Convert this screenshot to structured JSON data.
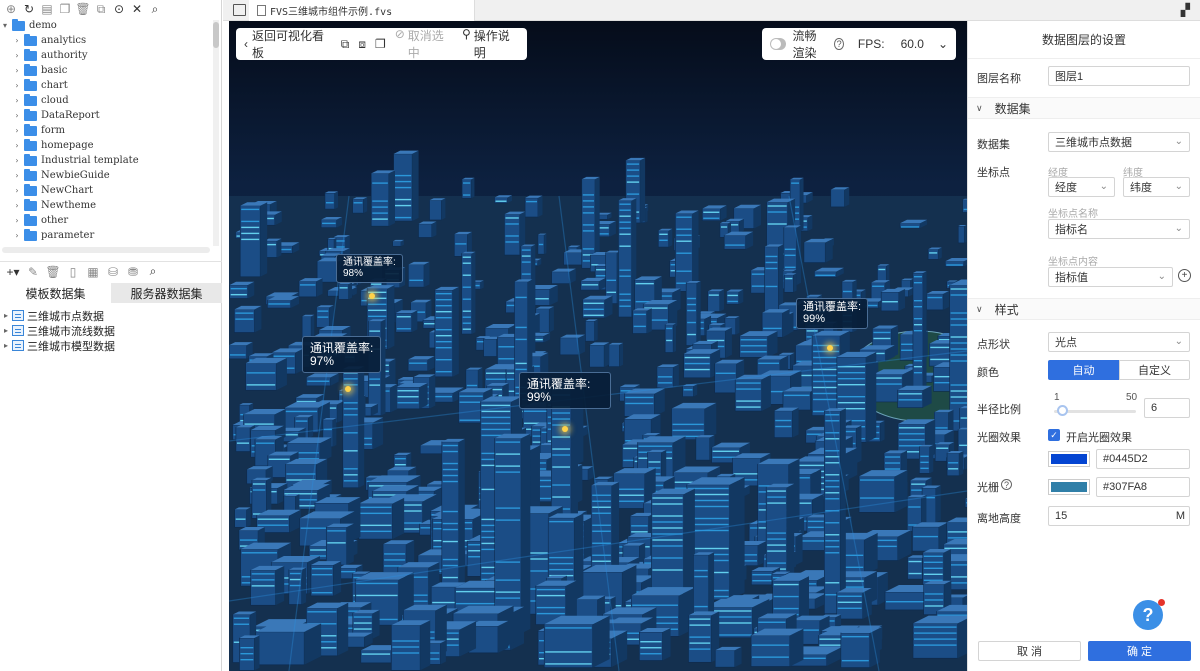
{
  "toolbar_icons": [
    "new-file-icon",
    "refresh-icon",
    "template-icon",
    "copy-icon",
    "delete-icon",
    "duplicate-icon",
    "locate-icon",
    "collapse-icon",
    "search-icon"
  ],
  "tree": {
    "root": "demo",
    "folders": [
      "analytics",
      "authority",
      "basic",
      "chart",
      "cloud",
      "DataReport",
      "form",
      "homepage",
      "Industrial template",
      "NewbieGuide",
      "NewChart",
      "Newtheme",
      "other",
      "parameter"
    ]
  },
  "dataset_tabs": {
    "template": "模板数据集",
    "server": "服务器数据集"
  },
  "datasets": [
    "三维城市点数据",
    "三维城市流线数据",
    "三维城市模型数据"
  ],
  "file_tab": {
    "label": "FVS三维城市组件示例.fvs"
  },
  "canvas_toolbar": {
    "back": "返回可视化看板",
    "cancel_select": "取消选中",
    "instructions": "操作说明",
    "smooth_render": "流畅渲染",
    "fps_label": "FPS:",
    "fps_value": "60.0"
  },
  "labels": [
    {
      "title": "通讯覆盖率:",
      "value": "98%"
    },
    {
      "title": "通讯覆盖率:",
      "value": "99%"
    },
    {
      "title": "通讯覆盖率:",
      "value": "97%"
    },
    {
      "title": "通讯覆盖率:",
      "value": "99%"
    }
  ],
  "panel": {
    "title": "数据图层的设置",
    "layer_name_label": "图层名称",
    "layer_name_value": "图层1",
    "dataset_section": "数据集",
    "dataset_label": "数据集",
    "dataset_value": "三维城市点数据",
    "coord_label": "坐标点",
    "lng_label": "经度",
    "lat_label": "纬度",
    "lng_value": "经度",
    "lat_value": "纬度",
    "coord_name_label": "坐标点名称",
    "coord_name_value": "指标名",
    "coord_content_label": "坐标点内容",
    "coord_content_value": "指标值",
    "style_section": "样式",
    "shape_label": "点形状",
    "shape_value": "光点",
    "color_label": "颜色",
    "color_auto": "自动",
    "color_custom": "自定义",
    "radius_label": "半径比例",
    "radius_min": "1",
    "radius_max": "50",
    "radius_value": "6",
    "halo_label": "光圈效果",
    "halo_checkbox": "开启光圈效果",
    "halo_color": "#0445D2",
    "grid_label": "光栅",
    "grid_color": "#307FA8",
    "height_label": "离地高度",
    "height_value": "15",
    "height_unit": "M",
    "cancel": "取 消",
    "confirm": "确 定",
    "help": "?"
  },
  "colors": {
    "accent": "#2f6fdf",
    "halo": "#0445D2",
    "grid": "#307FA8",
    "canvas_bg": "#0b1b33"
  }
}
